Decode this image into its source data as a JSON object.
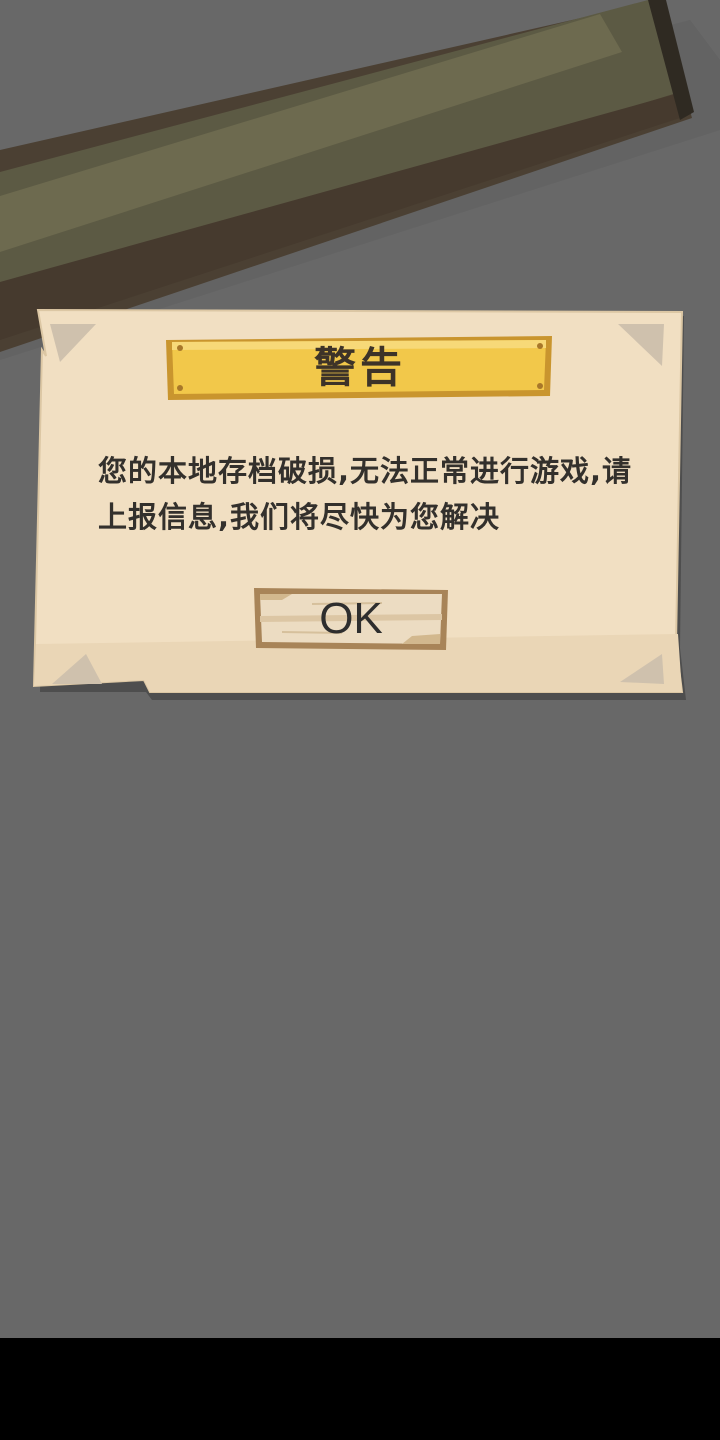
{
  "dialog": {
    "title": "警告",
    "message": "您的本地存档破损,无法正常进行游戏,请上报信息,我们将尽快为您解决",
    "ok_label": "OK"
  },
  "colors": {
    "background": "#686868",
    "parchment": "#f1dfc2",
    "banner": "#f2c84a",
    "nav_bar": "#000000"
  }
}
